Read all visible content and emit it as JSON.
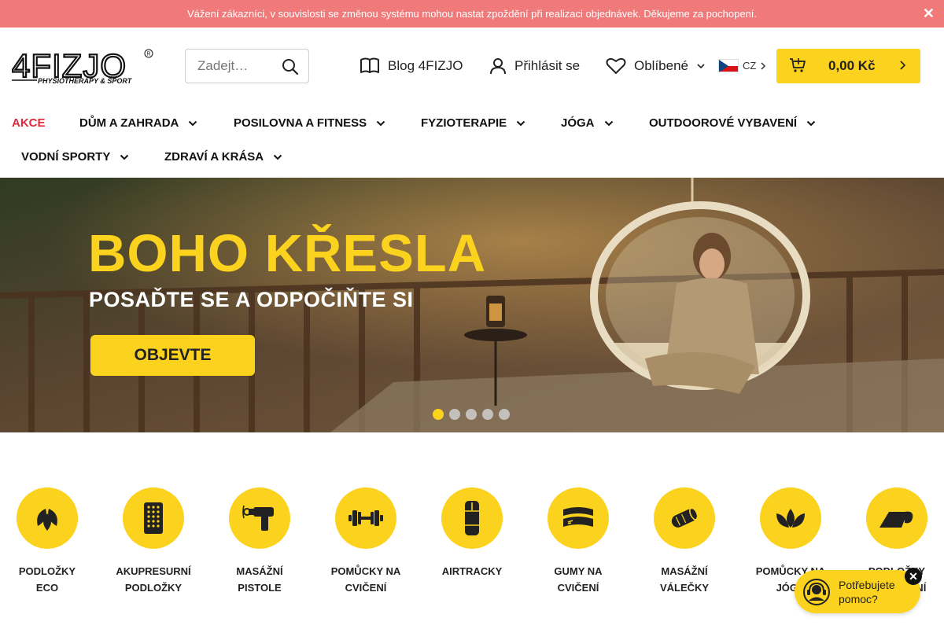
{
  "notice": {
    "text": "Vážení zákazníci, v souvislosti se změnou systému mohou nastat zpoždění při realizaci objednávek. Děkujeme za pochopení.",
    "close": "✕"
  },
  "header": {
    "logo_text": "4FIZJO",
    "logo_tagline": "PHYSIOTHERAPY & SPORT",
    "search_placeholder": "Zadejt…",
    "blog_label": "Blog 4FIZJO",
    "login_label": "Přihlásit se",
    "favorites_label": "Oblíbené",
    "language": "CZ",
    "cart_price": "0,00 Kč"
  },
  "nav": {
    "items": [
      "AKCE",
      "DŮM A ZAHRADA",
      "POSILOVNA A FITNESS",
      "FYZIOTERAPIE",
      "JÓGA",
      "OUTDOOROVÉ VYBAVENÍ",
      "VODNÍ SPORTY",
      "ZDRAVÍ A KRÁSA"
    ]
  },
  "hero": {
    "title": "BOHO KŘESLA",
    "subtitle": "POSAĎTE SE A ODPOČIŇTE SI",
    "cta": "OBJEVTE",
    "slides": 5,
    "active_slide": 1
  },
  "categories": [
    {
      "line1": "PODLOŽKY",
      "line2": "ECO",
      "icon": "leaf-icon"
    },
    {
      "line1": "AKUPRESURNÍ",
      "line2": "PODLOŽKY",
      "icon": "acupressure-mat-icon"
    },
    {
      "line1": "MASÁŽNÍ",
      "line2": "PISTOLE",
      "icon": "massage-gun-icon"
    },
    {
      "line1": "POMŮCKY NA",
      "line2": "CVIČENÍ",
      "icon": "dumbbell-icon"
    },
    {
      "line1": "AIRTRACKY",
      "line2": "",
      "icon": "airtrack-icon"
    },
    {
      "line1": "GUMY NA",
      "line2": "CVIČENÍ",
      "icon": "resistance-band-icon"
    },
    {
      "line1": "MASÁŽNÍ",
      "line2": "VÁLEČKY",
      "icon": "foam-roller-icon"
    },
    {
      "line1": "POMŮCKY NA",
      "line2": "JÓGU",
      "icon": "lotus-icon"
    },
    {
      "line1": "PODLOŽKY",
      "line2": "NA CVIČENÍ",
      "icon": "exercise-mat-icon"
    }
  ],
  "help": {
    "text": "Potřebujete pomoc?",
    "close": "✕"
  },
  "colors": {
    "accent": "#fbd21d",
    "notice": "#f07a7a",
    "sale": "#e0293a"
  }
}
